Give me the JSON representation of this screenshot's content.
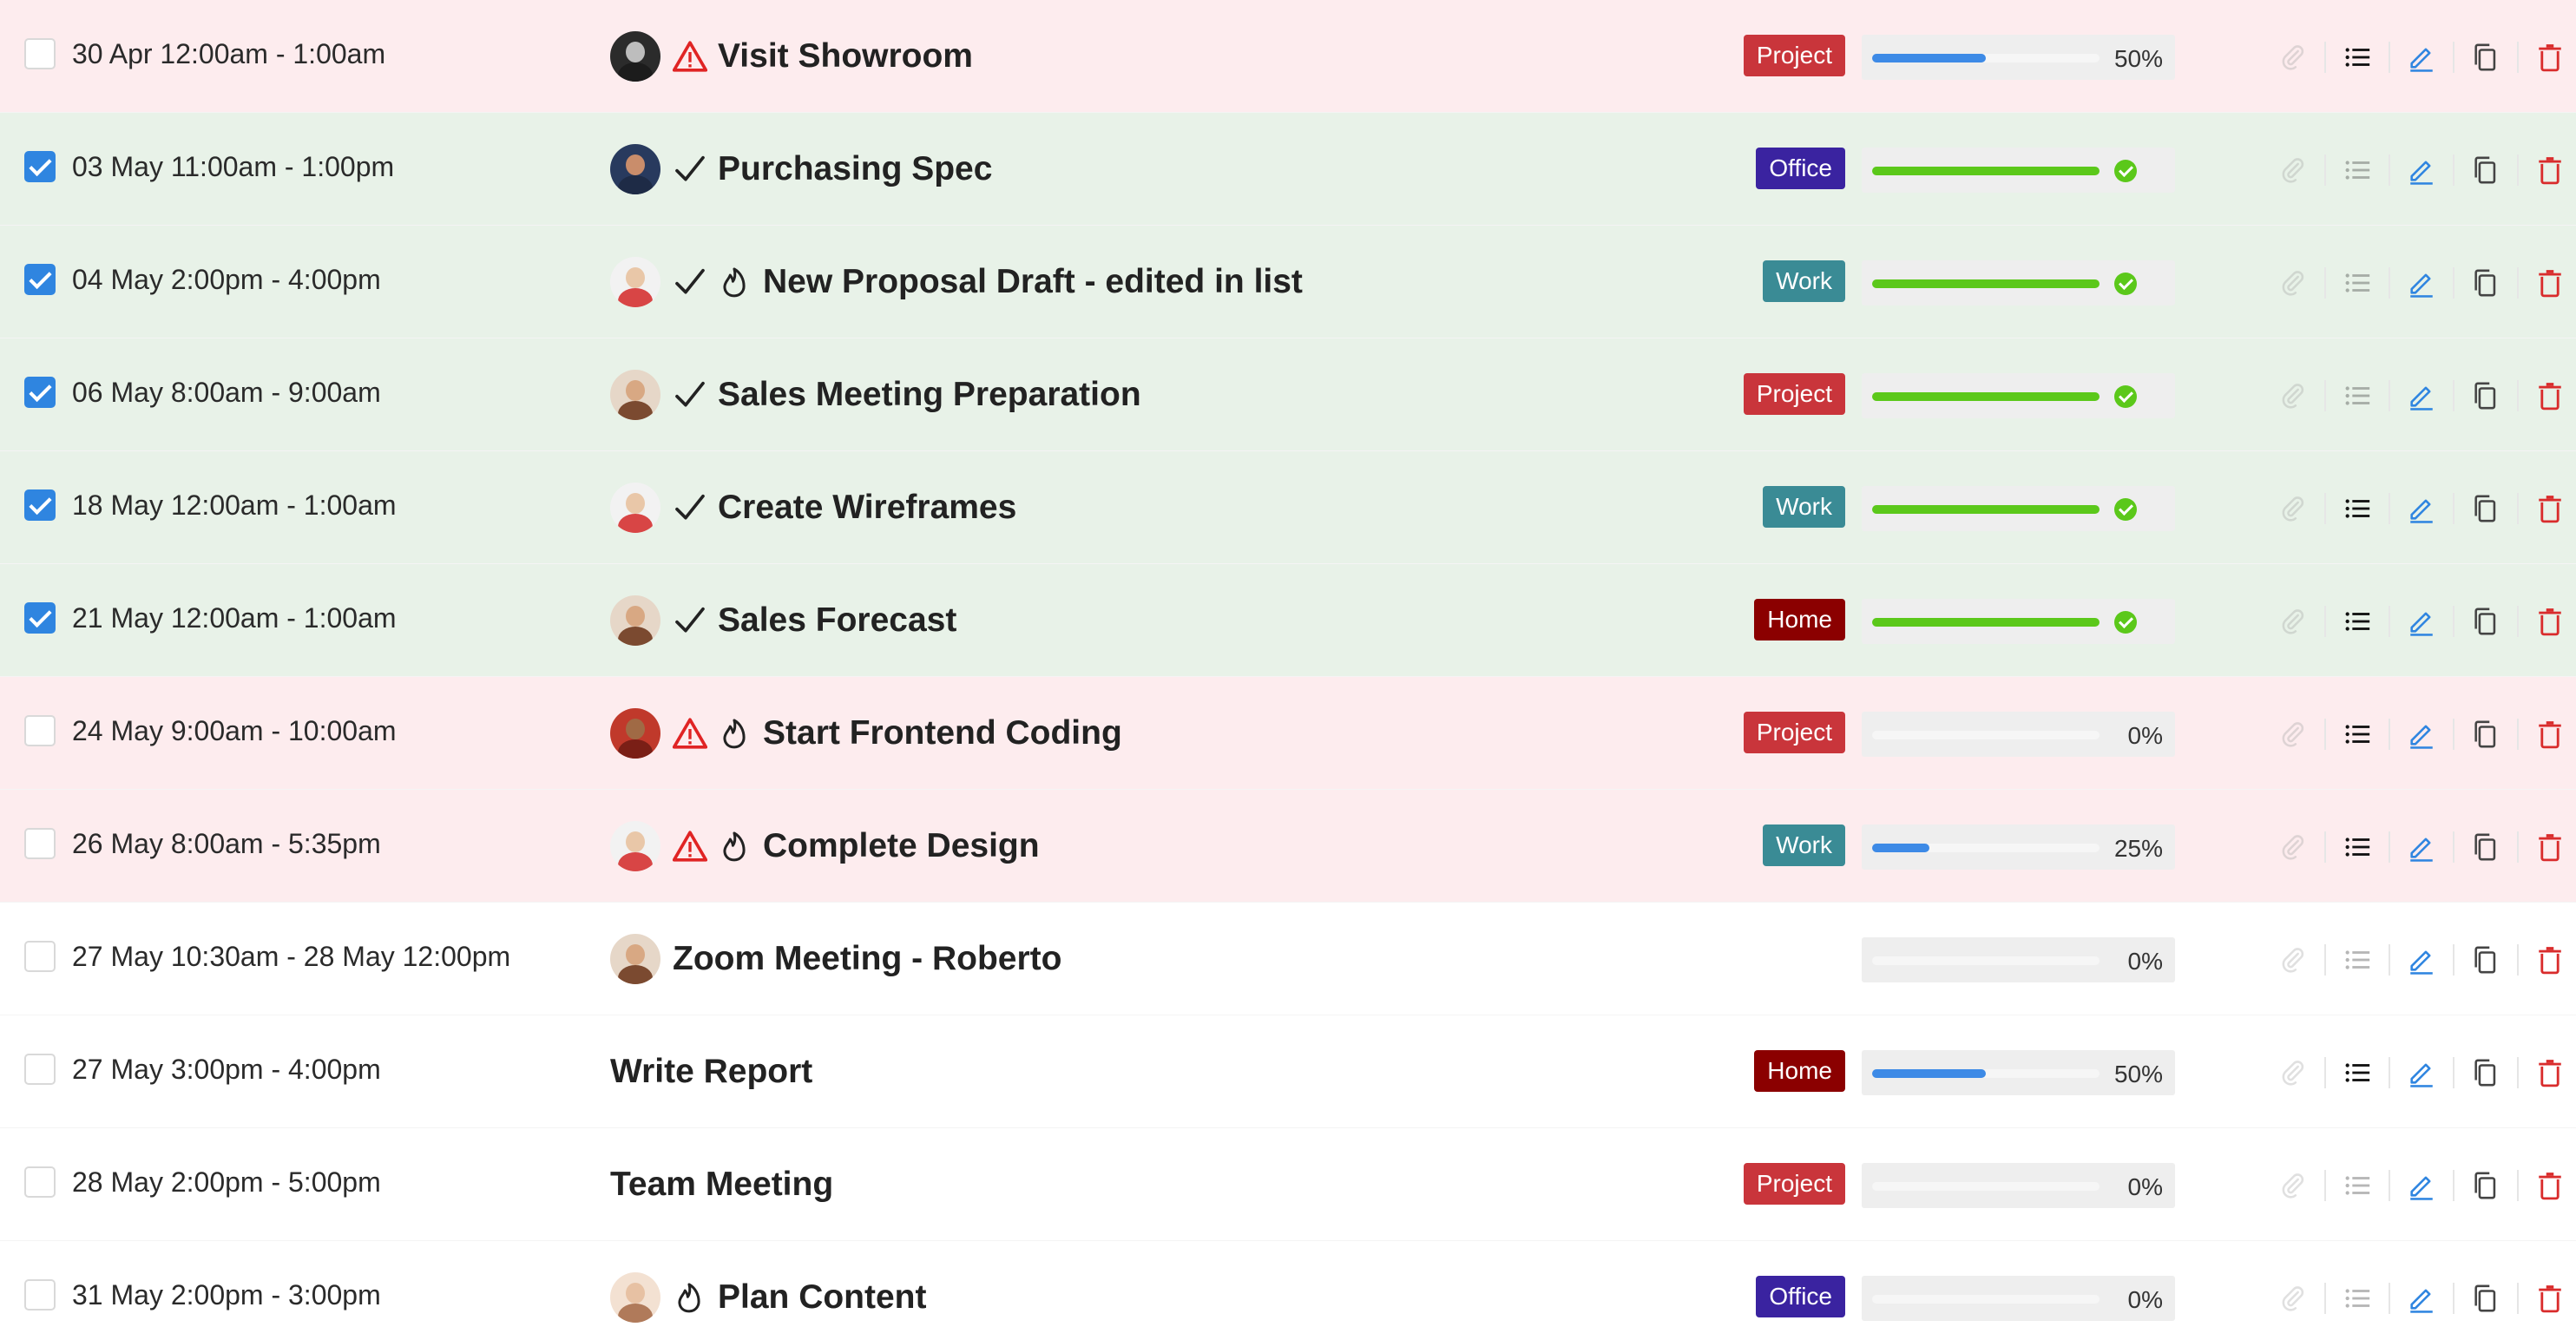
{
  "colors": {
    "overdue_row": "#fdecee",
    "done_row": "#e8f2e8",
    "progress_blue": "#3d8ae6",
    "progress_green": "#5bc81a",
    "warning_red": "#e02424",
    "tag_project": "#c9353b",
    "tag_office": "#3a23a0",
    "tag_work": "#3a8b95",
    "tag_home": "#8b0000",
    "edit_blue": "#2f85e0",
    "delete_red": "#d92c2c"
  },
  "tasks": [
    {
      "time": "30 Apr 12:00am - 1:00am",
      "title": "Visit Showroom",
      "checked": false,
      "status": "overdue",
      "avatar": "avatar-1",
      "warning": true,
      "completed": false,
      "urgent": false,
      "tag": "Project",
      "tag_color": "#c9353b",
      "progress": 0.5,
      "progress_label": "50%",
      "has_attachment": false,
      "has_checklist": true
    },
    {
      "time": "03 May 11:00am - 1:00pm",
      "title": "Purchasing Spec",
      "checked": true,
      "status": "done",
      "avatar": "avatar-2",
      "warning": false,
      "completed": true,
      "urgent": false,
      "tag": "Office",
      "tag_color": "#3a23a0",
      "progress": 1,
      "progress_label": "",
      "has_attachment": false,
      "has_checklist": false
    },
    {
      "time": "04 May 2:00pm - 4:00pm",
      "title": "New Proposal Draft - edited in list",
      "checked": true,
      "status": "done",
      "avatar": "avatar-3",
      "warning": false,
      "completed": true,
      "urgent": true,
      "tag": "Work",
      "tag_color": "#3a8b95",
      "progress": 1,
      "progress_label": "",
      "has_attachment": false,
      "has_checklist": false
    },
    {
      "time": "06 May 8:00am - 9:00am",
      "title": "Sales Meeting Preparation",
      "checked": true,
      "status": "done",
      "avatar": "avatar-4",
      "warning": false,
      "completed": true,
      "urgent": false,
      "tag": "Project",
      "tag_color": "#c9353b",
      "progress": 1,
      "progress_label": "",
      "has_attachment": false,
      "has_checklist": false
    },
    {
      "time": "18 May 12:00am - 1:00am",
      "title": "Create Wireframes",
      "checked": true,
      "status": "done",
      "avatar": "avatar-3",
      "warning": false,
      "completed": true,
      "urgent": false,
      "tag": "Work",
      "tag_color": "#3a8b95",
      "progress": 1,
      "progress_label": "",
      "has_attachment": false,
      "has_checklist": true
    },
    {
      "time": "21 May 12:00am - 1:00am",
      "title": "Sales Forecast",
      "checked": true,
      "status": "done",
      "avatar": "avatar-4",
      "warning": false,
      "completed": true,
      "urgent": false,
      "tag": "Home",
      "tag_color": "#8b0000",
      "progress": 1,
      "progress_label": "",
      "has_attachment": false,
      "has_checklist": true
    },
    {
      "time": "24 May 9:00am - 10:00am",
      "title": "Start Frontend Coding",
      "checked": false,
      "status": "overdue",
      "avatar": "avatar-5",
      "warning": true,
      "completed": false,
      "urgent": true,
      "tag": "Project",
      "tag_color": "#c9353b",
      "progress": 0,
      "progress_label": "0%",
      "has_attachment": false,
      "has_checklist": true
    },
    {
      "time": "26 May 8:00am - 5:35pm",
      "title": "Complete Design",
      "checked": false,
      "status": "overdue",
      "avatar": "avatar-3",
      "warning": true,
      "completed": false,
      "urgent": true,
      "tag": "Work",
      "tag_color": "#3a8b95",
      "progress": 0.25,
      "progress_label": "25%",
      "has_attachment": false,
      "has_checklist": true
    },
    {
      "time": "27 May 10:30am - 28 May 12:00pm",
      "title": "Zoom Meeting - Roberto",
      "checked": false,
      "status": "normal",
      "avatar": "avatar-4",
      "warning": false,
      "completed": false,
      "urgent": false,
      "tag": "",
      "tag_color": "",
      "progress": 0,
      "progress_label": "0%",
      "has_attachment": false,
      "has_checklist": false
    },
    {
      "time": "27 May 3:00pm - 4:00pm",
      "title": "Write Report",
      "checked": false,
      "status": "normal",
      "avatar": "",
      "warning": false,
      "completed": false,
      "urgent": false,
      "tag": "Home",
      "tag_color": "#8b0000",
      "progress": 0.5,
      "progress_label": "50%",
      "has_attachment": false,
      "has_checklist": true
    },
    {
      "time": "28 May 2:00pm - 5:00pm",
      "title": "Team Meeting",
      "checked": false,
      "status": "normal",
      "avatar": "",
      "warning": false,
      "completed": false,
      "urgent": false,
      "tag": "Project",
      "tag_color": "#c9353b",
      "progress": 0,
      "progress_label": "0%",
      "has_attachment": false,
      "has_checklist": false
    },
    {
      "time": "31 May 2:00pm - 3:00pm",
      "title": "Plan Content",
      "checked": false,
      "status": "normal",
      "avatar": "avatar-6",
      "warning": false,
      "completed": false,
      "urgent": true,
      "tag": "Office",
      "tag_color": "#3a23a0",
      "progress": 0,
      "progress_label": "0%",
      "has_attachment": false,
      "has_checklist": false
    }
  ],
  "action_icons": [
    "attachment-icon",
    "checklist-icon",
    "edit-icon",
    "duplicate-icon",
    "delete-icon"
  ]
}
